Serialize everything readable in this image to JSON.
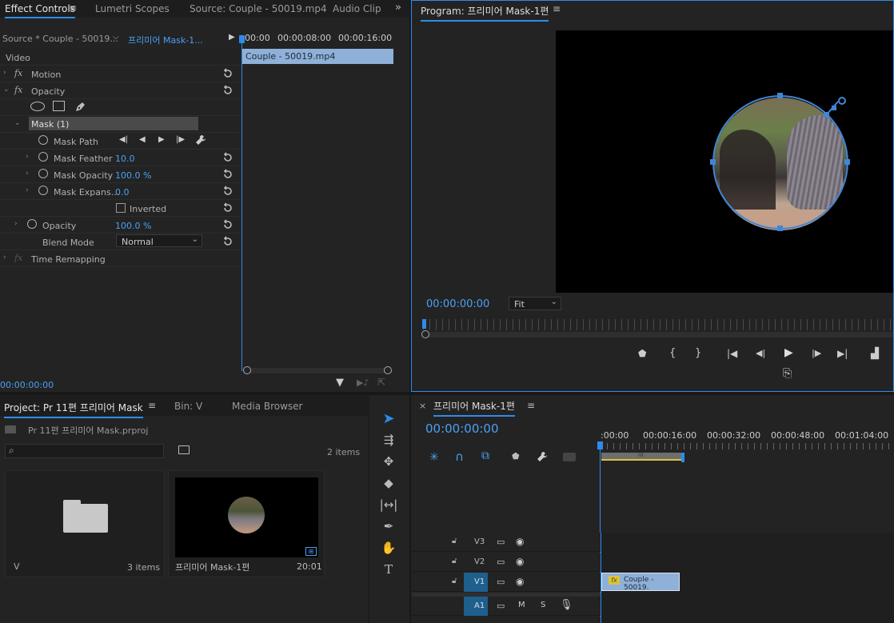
{
  "effect_controls": {
    "tabs": [
      "Effect Controls",
      "Lumetri Scopes",
      "Source: Couple - 50019.mp4",
      "Audio Clip"
    ],
    "source_label": "Source * Couple - 50019...",
    "sequence_label": "프리미어 Mask-1...",
    "ruler_ticks": [
      "00:00",
      "00:00:08:00",
      "00:00:16:00"
    ],
    "clip_label": "Couple - 50019.mp4",
    "section_video": "Video",
    "motion": "Motion",
    "opacity": "Opacity",
    "mask": "Mask (1)",
    "mask_path": "Mask Path",
    "mask_feather": {
      "label": "Mask Feather",
      "value": "10.0"
    },
    "mask_opacity": {
      "label": "Mask Opacity",
      "value": "100.0 %"
    },
    "mask_expansion": {
      "label": "Mask Expans...",
      "value": "0.0"
    },
    "inverted": "Inverted",
    "opacity_prop": {
      "label": "Opacity",
      "value": "100.0 %"
    },
    "blend_mode": {
      "label": "Blend Mode",
      "value": "Normal"
    },
    "time_remapping": "Time Remapping",
    "timecode": "00:00:00:00"
  },
  "program": {
    "title": "Program: 프리미어 Mask-1편",
    "timecode": "00:00:00:00",
    "fit": "Fit"
  },
  "project": {
    "tabs": [
      "Project: Pr 11편 프리미어 Mask",
      "Bin: V",
      "Media Browser"
    ],
    "file": "Pr 11편 프리미어 Mask.prproj",
    "item_count": "2 items",
    "bin_name": "V",
    "bin_count": "3 items",
    "seq_name": "프리미어 Mask-1편",
    "seq_duration": "20:01"
  },
  "timeline": {
    "title": "프리미어 Mask-1편",
    "timecode": "00:00:00:00",
    "ruler_ticks": [
      ":00:00",
      "00:00:16:00",
      "00:00:32:00",
      "00:00:48:00",
      "00:01:04:00"
    ],
    "tracks": [
      "V3",
      "V2",
      "V1",
      "A1"
    ],
    "clip_label": "Couple - 50019.",
    "fx_label": "fx",
    "a1_m": "M",
    "a1_s": "S"
  },
  "colors": {
    "accent": "#2d8ceb",
    "clip": "#8fb0d8",
    "timecode_blue": "#4aa0f5"
  }
}
